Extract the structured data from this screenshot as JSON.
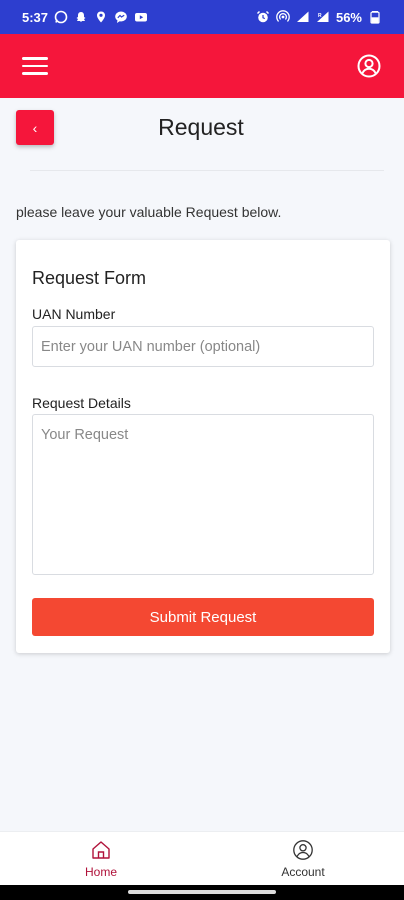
{
  "status_bar": {
    "time": "5:37",
    "battery": "56%"
  },
  "page": {
    "title": "Request",
    "back_glyph": "‹",
    "intro": "please leave your valuable Request below."
  },
  "form": {
    "title": "Request Form",
    "uan_label": "UAN Number",
    "uan_placeholder": "Enter your UAN number (optional)",
    "uan_value": "",
    "details_label": "Request Details",
    "details_placeholder": "Your Request",
    "details_value": "",
    "submit_label": "Submit Request"
  },
  "bottom_nav": [
    {
      "label": "Home",
      "icon": "home-icon",
      "active": true
    },
    {
      "label": "Account",
      "icon": "account-icon",
      "active": false
    }
  ],
  "colors": {
    "status_bar": "#2d3ecf",
    "brand": "#f5163b",
    "submit": "#f44832",
    "active_nav": "#b0123a"
  },
  "icons": {
    "status_left": [
      "whatsapp-icon",
      "snapchat-icon",
      "location-icon",
      "messenger-icon",
      "youtube-icon"
    ],
    "status_right": [
      "alarm-icon",
      "hotspot-icon",
      "wifi-icon",
      "signal-icon",
      "battery-icon"
    ],
    "app_bar": [
      "menu-icon",
      "account-circle-icon"
    ]
  }
}
